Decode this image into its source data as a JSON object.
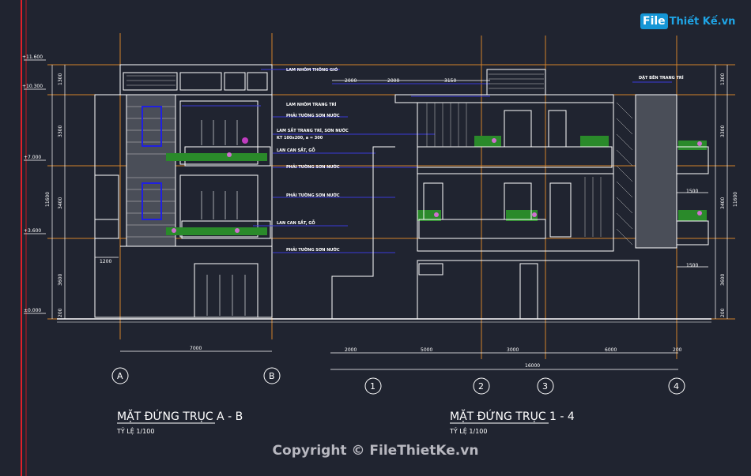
{
  "logo": {
    "file": "File",
    "rest": "Thiết Kế.vn"
  },
  "copyright": "Copyright © FileThietKe.vn",
  "left_view": {
    "title": "MẶT ĐỨNG TRỤC A - B",
    "scale": "TỶ LỆ 1/100",
    "axes": [
      "A",
      "B"
    ],
    "dim_bottom": "7000",
    "dim_left_small": "1200",
    "levels": [
      "+11.600",
      "+10.300",
      "+7.000",
      "+3.600",
      "±0.000"
    ],
    "dims_left": [
      "1300",
      "3300",
      "3400",
      "3600",
      "200"
    ],
    "dim_total": "11600",
    "notes": [
      "LAM NHÔM TRANG TRÍ",
      "PHẢI TƯỜNG SƠN NƯỚC",
      "LAM SẮT TRANG TRÍ, SƠN NƯỚC",
      "KT 100x200, a = 300",
      "LAN CAN SẮT, GỖ",
      "PHẢI TƯỜNG SƠN NƯỚC",
      "PHẢI TƯỜNG SƠN NƯỚC",
      "LAN CAN SẮT, GỖ",
      "PHẢI TƯỜNG SƠN NƯỚC"
    ],
    "top_note": "LAM NHÔM THÔNG GIÓ"
  },
  "right_view": {
    "title": "MẶT ĐỨNG TRỤC 1 - 4",
    "scale": "TỶ LỆ 1/100",
    "axes": [
      "1",
      "2",
      "3",
      "4"
    ],
    "dims_bottom": [
      "2000",
      "5000",
      "3000",
      "6000",
      "200"
    ],
    "dim_total": "16000",
    "dims_top": [
      "2000",
      "2000",
      "3150"
    ],
    "top_right_note": "DẬT BÊN TRANG TRÍ",
    "dims_right": [
      "1300",
      "3300",
      "3400",
      "3600",
      "200"
    ],
    "dim_right_total": "11600",
    "side_dims": [
      "1500",
      "1500"
    ]
  }
}
